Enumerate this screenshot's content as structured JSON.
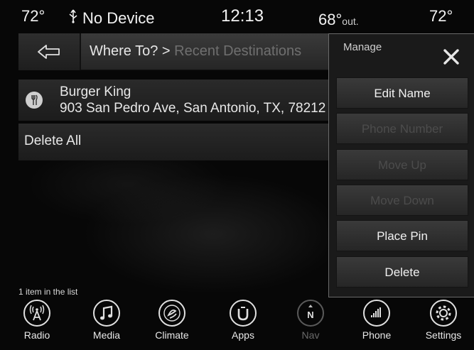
{
  "status_bar": {
    "temp_left": "72°",
    "device": "No Device",
    "clock": "12:13",
    "outside_temp": "68°",
    "outside_suffix": "out.",
    "temp_right": "72°"
  },
  "header": {
    "breadcrumb_current": "Where To? >",
    "breadcrumb_rest": " Recent Destinations"
  },
  "list": {
    "items": [
      {
        "name": "Burger King",
        "address": "903 San Pedro Ave, San Antonio, TX, 78212"
      }
    ],
    "delete_all_label": "Delete All",
    "count_text": "1 item in the list"
  },
  "manage_panel": {
    "title": "Manage",
    "buttons": [
      {
        "label": "Edit Name",
        "enabled": true
      },
      {
        "label": "Phone Number",
        "enabled": false
      },
      {
        "label": "Move Up",
        "enabled": false
      },
      {
        "label": "Move Down",
        "enabled": false
      },
      {
        "label": "Place Pin",
        "enabled": true
      },
      {
        "label": "Delete",
        "enabled": true
      }
    ]
  },
  "bottom_nav": [
    {
      "label": "Radio",
      "icon": "radio-icon"
    },
    {
      "label": "Media",
      "icon": "music-note-icon"
    },
    {
      "label": "Climate",
      "icon": "climate-icon"
    },
    {
      "label": "Apps",
      "icon": "apps-icon"
    },
    {
      "label": "Nav",
      "icon": "compass-icon",
      "dimmed": true
    },
    {
      "label": "Phone",
      "icon": "phone-signal-icon"
    },
    {
      "label": "Settings",
      "icon": "gear-icon"
    }
  ],
  "colors": {
    "background": "#070707",
    "button_face": "#303030",
    "text": "#e8e8e8",
    "disabled_text": "#4c4c4c"
  }
}
